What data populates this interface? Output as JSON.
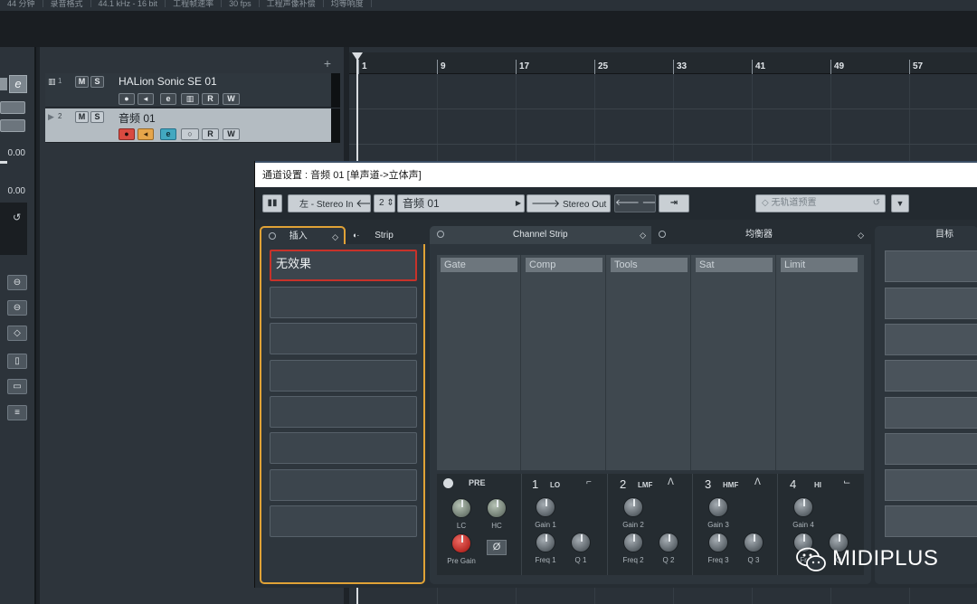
{
  "topbar": {
    "items": [
      "44 分钟",
      "录音格式",
      "44.1 kHz - 16 bit",
      "工程帧速率",
      "30 fps",
      "工程声像补偿",
      "均等响度"
    ]
  },
  "inspector": {
    "values": [
      "0.00",
      "0.00"
    ]
  },
  "tracks": [
    {
      "num": "1",
      "name": "HALion Sonic SE 01",
      "m": "M",
      "s": "S",
      "r": "R",
      "w": "W",
      "e": "e"
    },
    {
      "num": "2",
      "name": "音频 01",
      "m": "M",
      "s": "S",
      "r": "R",
      "w": "W",
      "e": "e"
    }
  ],
  "ruler": {
    "bars": [
      "1",
      "9",
      "17",
      "25",
      "33",
      "41",
      "49",
      "57"
    ]
  },
  "channel_window": {
    "title": "通道设置 : 音频 01 [单声道->立体声]",
    "toolbar": {
      "input": "左 - Stereo In",
      "channel_num": "2",
      "channel_name": "音频 01",
      "output": "Stereo Out",
      "preset": "无轨道预置"
    },
    "tabs": {
      "inserts": "插入",
      "strip": "Strip",
      "channel_strip": "Channel Strip",
      "eq": "均衡器",
      "target": "目标"
    },
    "insert_slot_1": "无效果",
    "strip_modules": [
      "Gate",
      "Comp",
      "Tools",
      "Sat",
      "Limit"
    ],
    "pre": {
      "label": "PRE",
      "lc": "LC",
      "hc": "HC",
      "pre_gain": "Pre Gain",
      "phase": "Ø"
    },
    "bands": [
      {
        "num": "1",
        "name": "LO",
        "gain": "Gain 1",
        "freq": "Freq 1",
        "q": "Q 1"
      },
      {
        "num": "2",
        "name": "LMF",
        "gain": "Gain 2",
        "freq": "Freq 2",
        "q": "Q 2"
      },
      {
        "num": "3",
        "name": "HMF",
        "gain": "Gain 3",
        "freq": "Freq 3",
        "q": "Q 3"
      },
      {
        "num": "4",
        "name": "HI",
        "gain": "Gain 4",
        "freq": "Fr",
        "q": "Q"
      }
    ]
  },
  "watermark": "MIDIPLUS",
  "colors": {
    "insert_border": "#e0a236",
    "record": "#c8322a",
    "monitor": "#e0a236",
    "edit": "#3a9fb8"
  }
}
